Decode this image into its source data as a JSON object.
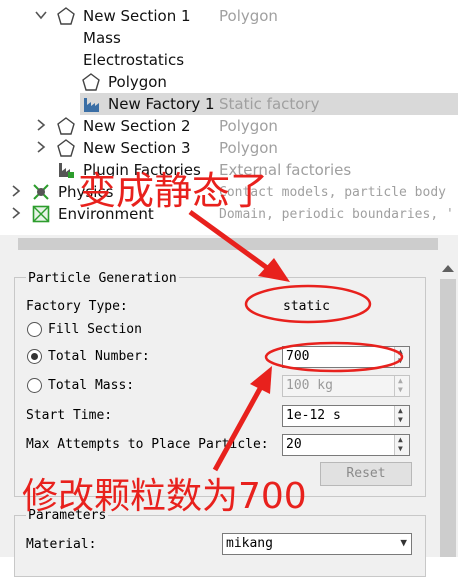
{
  "tree": {
    "items": [
      {
        "label": "New Section 1",
        "desc": "Polygon",
        "icon": "polygon-icon"
      },
      {
        "label": "Mass"
      },
      {
        "label": "Electrostatics"
      },
      {
        "label": "Polygon",
        "icon": "polygon-icon"
      },
      {
        "label": "New Factory 1",
        "desc": "Static factory",
        "icon": "factory-icon"
      },
      {
        "label": "New Section 2",
        "desc": "Polygon",
        "icon": "polygon-icon"
      },
      {
        "label": "New Section 3",
        "desc": "Polygon",
        "icon": "polygon-icon"
      },
      {
        "label": "Plugin Factories",
        "desc": "External factories",
        "icon": "plugin-factory-icon"
      },
      {
        "label": "Physics",
        "desc": "Contact models, particle body",
        "icon": "physics-icon"
      },
      {
        "label": "Environment",
        "desc": "Domain, periodic boundaries, '",
        "icon": "environment-icon"
      }
    ]
  },
  "particle_generation": {
    "title": "Particle Generation",
    "factory_type_label": "Factory Type:",
    "factory_type_value": "static",
    "fill_section_label": "Fill Section",
    "total_number_label": "Total Number:",
    "total_number_value": "700",
    "total_mass_label": "Total Mass:",
    "total_mass_value": "100 kg",
    "start_time_label": "Start Time:",
    "start_time_value": "1e-12 s",
    "max_attempts_label": "Max Attempts to Place Particle:",
    "max_attempts_value": "20",
    "reset_label": "Reset"
  },
  "parameters": {
    "title": "Parameters",
    "material_label": "Material:",
    "material_value": "mikang"
  },
  "annotations": {
    "top_text": "变成静态了",
    "bottom_text": "修改颗粒数为700",
    "color": "#e8211d"
  }
}
